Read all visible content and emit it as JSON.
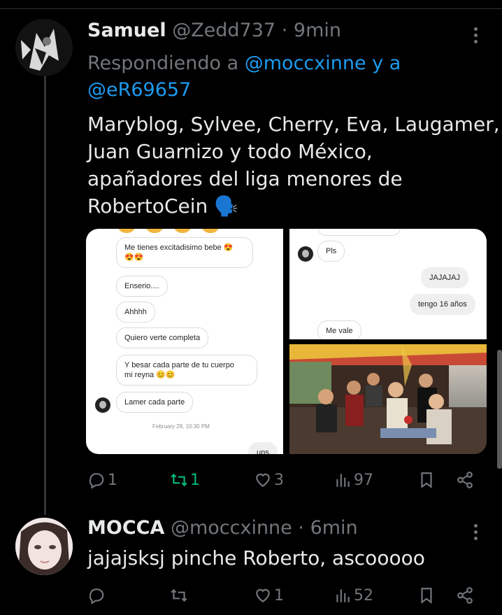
{
  "tweets": [
    {
      "display_name": "Samuel",
      "handle": "@Zedd737",
      "sep": "·",
      "time": "9min",
      "reply_prefix": "Respondiendo a",
      "reply_handles": "@moccxinne y a @eR69657",
      "text_lines": [
        "Maryblog, Sylvee, Cherry, Eva, Laugamer,",
        "Juan Guarnizo y todo México,",
        "apañadores del liga menores de",
        "RobertoCein 🗣️"
      ],
      "media": {
        "left_chat": {
          "messages": [
            "Me tienes excitadisimo bebe 😍",
            "😍😍",
            "Enserio....",
            "Ahhhh",
            "Quiero verte completa",
            "Y besar cada parte de tu cuerpo",
            "mi reyna 😊😊",
            "Lamer cada parte",
            "ups"
          ],
          "timestamp": "February 28, 10:30 PM"
        },
        "right_chat": {
          "messages": [
            "Pls",
            "JAJAJAJ",
            "tengo 16 años",
            "Me vale"
          ]
        }
      },
      "actions": {
        "reply": "1",
        "retweet": "1",
        "like": "3",
        "views": "97"
      }
    },
    {
      "display_name": "MOCCA",
      "handle": "@moccxinne",
      "sep": "·",
      "time": "6min",
      "text_lines": [
        "jajajsksj pinche Roberto, ascooooo"
      ],
      "actions": {
        "reply": "",
        "retweet": "",
        "like": "1",
        "views": "52"
      }
    }
  ],
  "icons": [
    "reply-icon",
    "retweet-icon",
    "like-icon",
    "views-icon",
    "bookmark-icon",
    "share-icon",
    "more-icon"
  ],
  "colors": {
    "background": "#000000",
    "text": "#e7e9ea",
    "muted": "#71767b",
    "link": "#1d9bf0",
    "retweet_active": "#00ba7c"
  }
}
